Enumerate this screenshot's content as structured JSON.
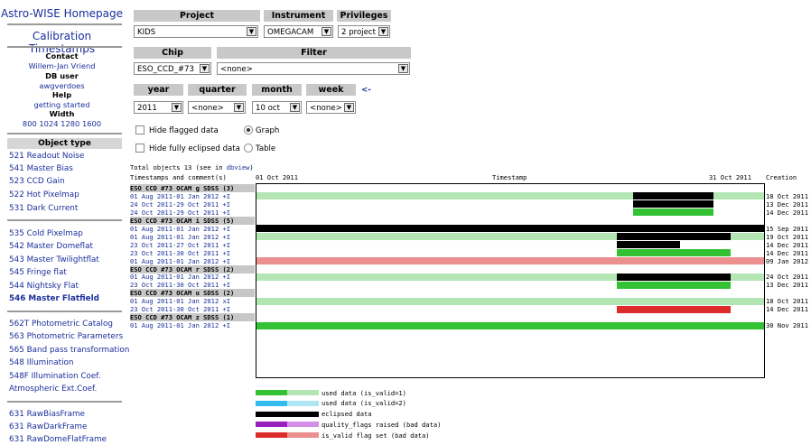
{
  "sidebar": {
    "homepage": "Astro-WISE Homepage",
    "calib": "Calibration Timestamps",
    "contact_h": "Contact",
    "contact": "Willem-Jan Vriend",
    "dbuser_h": "DB user",
    "dbuser": "awgverdoes",
    "help_h": "Help",
    "help": "getting started",
    "width_h": "Width",
    "widths": [
      "800",
      "1024",
      "1280",
      "1600"
    ],
    "object_type_h": "Object type",
    "links": [
      "521 Readout Noise",
      "541 Master Bias",
      "523 CCD Gain",
      "522 Hot Pixelmap",
      "531 Dark Current",
      "535 Cold Pixelmap",
      "542 Master Domeflat",
      "543 Master Twilightflat",
      "545 Fringe flat",
      "544 Nightsky Flat",
      "546 Master Flatfield",
      "562T Photometric Catalog",
      "563 Photometric Parameters",
      "565 Band pass transformation",
      "548 Illumination",
      "548F Illumination Coef.",
      "Atmospheric Ext.Coef.",
      "631 RawBiasFrame",
      "631 RawDarkFrame",
      "631 RawDomeFlatFrame"
    ]
  },
  "form": {
    "project_h": "Project",
    "project_val": "KIDS",
    "instrument_h": "Instrument",
    "instrument_val": "OMEGACAM",
    "privileges_h": "Privileges",
    "privileges_val": "2 project",
    "chip_h": "Chip",
    "chip_val": "ESO_CCD_#73",
    "filter_h": "Filter",
    "filter_val": "<none>",
    "year_h": "year",
    "year_val": "2011",
    "quarter_h": "quarter",
    "quarter_val": "<none>",
    "month_h": "month",
    "month_val": "10 oct",
    "week_h": "week",
    "week_val": "<none>",
    "back_arrow": "<-",
    "hide_flagged": "Hide flagged data",
    "graph": "Graph",
    "hide_eclipsed": "Hide fully eclipsed data",
    "table": "Table"
  },
  "summary": {
    "total": "Total objects 13 (see in ",
    "dbview": "dbview",
    "total_end": ")"
  },
  "header": {
    "timestamps": "Timestamps and comment(s)",
    "start": "01 Oct 2011",
    "mid": "Timestamp",
    "end": "31 Oct 2011",
    "creation": "Creation"
  },
  "groups": [
    {
      "label": "ESO CCD #73 OCAM g SDSS (3)",
      "rows": [
        {
          "label": "01 Aug 2011-01 Jan 2012 +I",
          "bg": "#b3e6b3",
          "blocks": [
            {
              "start": 0.742,
              "end": 0.9,
              "color": "#000000"
            }
          ],
          "created": "18 Oct 2011"
        },
        {
          "label": "24 Oct 2011-29 Oct 2011 +I",
          "bg": "",
          "blocks": [
            {
              "start": 0.742,
              "end": 0.9,
              "color": "#000000"
            }
          ],
          "created": "13 Dec 2011"
        },
        {
          "label": "24 Oct 2011-29 Oct 2011 +I",
          "bg": "",
          "blocks": [
            {
              "start": 0.742,
              "end": 0.9,
              "color": "#33c233"
            }
          ],
          "created": "14 Dec 2011"
        }
      ]
    },
    {
      "label": "ESO CCD #73 OCAM i SDSS (5)",
      "rows": [
        {
          "label": "01 Aug 2011-01 Jan 2012 +I",
          "bg": "#000000",
          "blocks": [],
          "created": "15 Sep 2011"
        },
        {
          "label": "01 Aug 2011-01 Jan 2012 +I",
          "bg": "#b3e6b3",
          "blocks": [
            {
              "start": 0.71,
              "end": 0.935,
              "color": "#000000"
            }
          ],
          "created": "19 Oct 2011"
        },
        {
          "label": "23 Oct 2011-27 Oct 2011 +I",
          "bg": "",
          "blocks": [
            {
              "start": 0.71,
              "end": 0.835,
              "color": "#000000"
            }
          ],
          "created": "14 Dec 2011"
        },
        {
          "label": "23 Oct 2011-30 Oct 2011 +I",
          "bg": "",
          "blocks": [
            {
              "start": 0.71,
              "end": 0.935,
              "color": "#33c233"
            }
          ],
          "created": "14 Dec 2011"
        },
        {
          "label": "01 Aug 2011-01 Jan 2012 +I",
          "bg": "#ec8f8f",
          "blocks": [],
          "created": "09 Jan 2012"
        }
      ]
    },
    {
      "label": "ESO CCD #73 OCAM r SDSS (2)",
      "rows": [
        {
          "label": "01 Aug 2011-01 Jan 2012 +I",
          "bg": "#b3e6b3",
          "blocks": [
            {
              "start": 0.71,
              "end": 0.935,
              "color": "#000000"
            }
          ],
          "created": "24 Oct 2011"
        },
        {
          "label": "23 Oct 2011-30 Oct 2011 +I",
          "bg": "",
          "blocks": [
            {
              "start": 0.71,
              "end": 0.935,
              "color": "#33c233"
            }
          ],
          "created": "13 Dec 2011"
        }
      ]
    },
    {
      "label": "ESO CCD #73 OCAM u SDSS (2)",
      "rows": [
        {
          "label": "01 Aug 2011-01 Jan 2012 xI",
          "bg": "#b3e6b3",
          "blocks": [],
          "created": "18 Oct 2011"
        },
        {
          "label": "23 Oct 2011-30 Oct 2011 +I",
          "bg": "",
          "blocks": [
            {
              "start": 0.71,
              "end": 0.935,
              "color": "#dd2a2a"
            }
          ],
          "created": "14 Dec 2011"
        }
      ]
    },
    {
      "label": "ESO CCD #73 OCAM z SDSS (1)",
      "rows": [
        {
          "label": "01 Aug 2011-01 Jan 2012 +I",
          "bg": "#33c233",
          "blocks": [],
          "created": "30 Nov 2011"
        }
      ]
    }
  ],
  "legend": [
    {
      "c1": "#33c233",
      "c2": "#b3e6b3",
      "text": "used data (is_valid=1)"
    },
    {
      "c1": "#33bbee",
      "c2": "#aee6f5",
      "text": "used data (is_valid=2)"
    },
    {
      "c1": "#000000",
      "c2": "#000000",
      "text": "eclipsed data"
    },
    {
      "c1": "#9a1fbf",
      "c2": "#d48ee6",
      "text": "quality_flags raised (bad data)"
    },
    {
      "c1": "#dd2a2a",
      "c2": "#ec8f8f",
      "text": "is_valid flag set (bad data)"
    }
  ]
}
